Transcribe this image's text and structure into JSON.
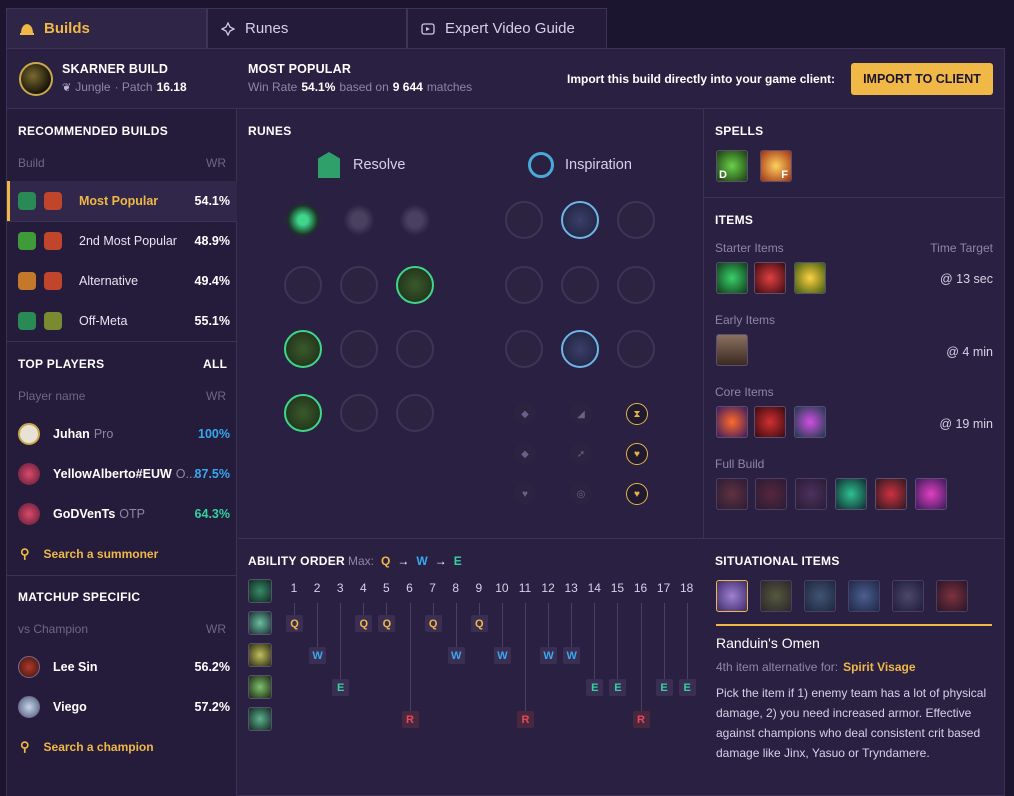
{
  "tabs": [
    {
      "label": "Builds"
    },
    {
      "label": "Runes"
    },
    {
      "label": "Expert Video Guide"
    }
  ],
  "header": {
    "champion_title": "SKARNER BUILD",
    "role": "Jungle",
    "patch_label": "· Patch",
    "patch": "16.18",
    "most_popular": "MOST POPULAR",
    "winrate_label": "Win Rate",
    "winrate": "54.1%",
    "based_on": "based on",
    "matches": "9 644",
    "matches_label": "matches",
    "import_text": "Import this build directly into your game client:",
    "import_button": "IMPORT TO CLIENT"
  },
  "recommended": {
    "title": "RECOMMENDED BUILDS",
    "col_build": "Build",
    "col_wr": "WR",
    "rows": [
      {
        "name": "Most Popular",
        "wr": "54.1%"
      },
      {
        "name": "2nd Most Popular",
        "wr": "48.9%"
      },
      {
        "name": "Alternative",
        "wr": "49.4%"
      },
      {
        "name": "Off-Meta",
        "wr": "55.1%"
      }
    ]
  },
  "top_players": {
    "title": "TOP PLAYERS",
    "all": "ALL",
    "col_name": "Player name",
    "col_wr": "WR",
    "rows": [
      {
        "name": "Juhan",
        "tag": "Pro",
        "wr": "100%"
      },
      {
        "name": "YellowAlberto#EUW",
        "tag": "O...",
        "wr": "87.5%"
      },
      {
        "name": "GoDVenTs",
        "tag": "OTP",
        "wr": "64.3%"
      }
    ],
    "search": "Search a summoner"
  },
  "matchup": {
    "title": "MATCHUP SPECIFIC",
    "col_vs": "vs Champion",
    "col_wr": "WR",
    "rows": [
      {
        "name": "Lee Sin",
        "wr": "56.2%"
      },
      {
        "name": "Viego",
        "wr": "57.2%"
      }
    ],
    "search": "Search a champion"
  },
  "runes": {
    "title": "RUNES",
    "primary": "Resolve",
    "secondary": "Inspiration"
  },
  "spells": {
    "title": "SPELLS",
    "keys": [
      "D",
      "F"
    ]
  },
  "items": {
    "title": "ITEMS",
    "starter": "Starter Items",
    "time_target": "Time Target",
    "starter_time": "@ 13 sec",
    "early": "Early Items",
    "early_time": "@ 4 min",
    "core": "Core Items",
    "core_time": "@ 19 min",
    "full": "Full Build"
  },
  "ability": {
    "title": "ABILITY ORDER",
    "max_label": "Max:",
    "max": [
      "Q",
      "W",
      "E"
    ],
    "levels": [
      "1",
      "2",
      "3",
      "4",
      "5",
      "6",
      "7",
      "8",
      "9",
      "10",
      "11",
      "12",
      "13",
      "14",
      "15",
      "16",
      "17",
      "18"
    ]
  },
  "situational": {
    "title": "SITUATIONAL ITEMS",
    "item_name": "Randuin's Omen",
    "alt_label": "4th item alternative for:",
    "alt_item": "Spirit Visage",
    "desc": "Pick the item if 1) enemy team has a lot of physical damage, 2) you need increased armor. Effective against champions who deal consistent crit based damage like Jinx, Yasuo or Tryndamere."
  },
  "colors": {
    "accent": "#f0b847",
    "blue": "#39a7f0",
    "green": "#34d1a0",
    "red": "#e9475c"
  }
}
